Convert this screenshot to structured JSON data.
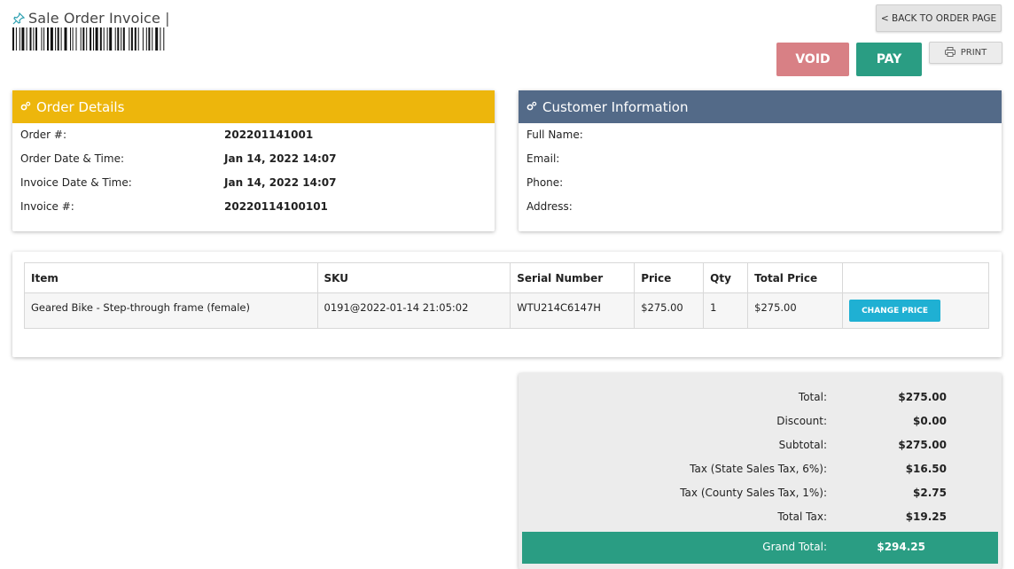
{
  "header": {
    "title": "Sale Order Invoice",
    "back_label": "< BACK TO ORDER PAGE",
    "void_label": "VOID",
    "pay_label": "PAY",
    "print_label": "PRINT"
  },
  "order_details": {
    "title": "Order Details",
    "rows": [
      {
        "label": "Order #:",
        "value": "202201141001"
      },
      {
        "label": "Order Date & Time:",
        "value": "Jan 14, 2022 14:07"
      },
      {
        "label": "Invoice Date & Time:",
        "value": "Jan 14, 2022 14:07"
      },
      {
        "label": "Invoice #:",
        "value": "20220114100101"
      }
    ]
  },
  "customer_info": {
    "title": "Customer Information",
    "rows": [
      {
        "label": "Full Name:",
        "value": ""
      },
      {
        "label": "Email:",
        "value": ""
      },
      {
        "label": "Phone:",
        "value": ""
      },
      {
        "label": "Address:",
        "value": ""
      }
    ]
  },
  "items": {
    "columns": [
      "Item",
      "SKU",
      "Serial Number",
      "Price",
      "Qty",
      "Total Price",
      ""
    ],
    "rows": [
      {
        "item": "Geared Bike - Step-through frame (female)",
        "sku": "0191@2022-01-14 21:05:02",
        "serial": "WTU214C6147H",
        "price": "$275.00",
        "qty": "1",
        "total": "$275.00",
        "action": "CHANGE PRICE"
      }
    ]
  },
  "totals": {
    "rows": [
      {
        "label": "Total:",
        "value": "$275.00"
      },
      {
        "label": "Discount:",
        "value": "$0.00"
      },
      {
        "label": "Subtotal:",
        "value": "$275.00"
      },
      {
        "label": "Tax (State Sales Tax, 6%):",
        "value": "$16.50"
      },
      {
        "label": "Tax (County Sales Tax, 1%):",
        "value": "$2.75"
      },
      {
        "label": "Total Tax:",
        "value": "$19.25"
      }
    ],
    "grand_label": "Grand Total:",
    "grand_value": "$294.25"
  },
  "icons": {
    "title_icon": "pin-icon",
    "panel_icon": "cogs-icon",
    "print_icon": "printer-icon"
  },
  "colors": {
    "order_header": "#edb60c",
    "customer_header": "#536a88",
    "pay": "#2a9d83",
    "void": "#d88085",
    "change_price": "#1fb0d3"
  }
}
